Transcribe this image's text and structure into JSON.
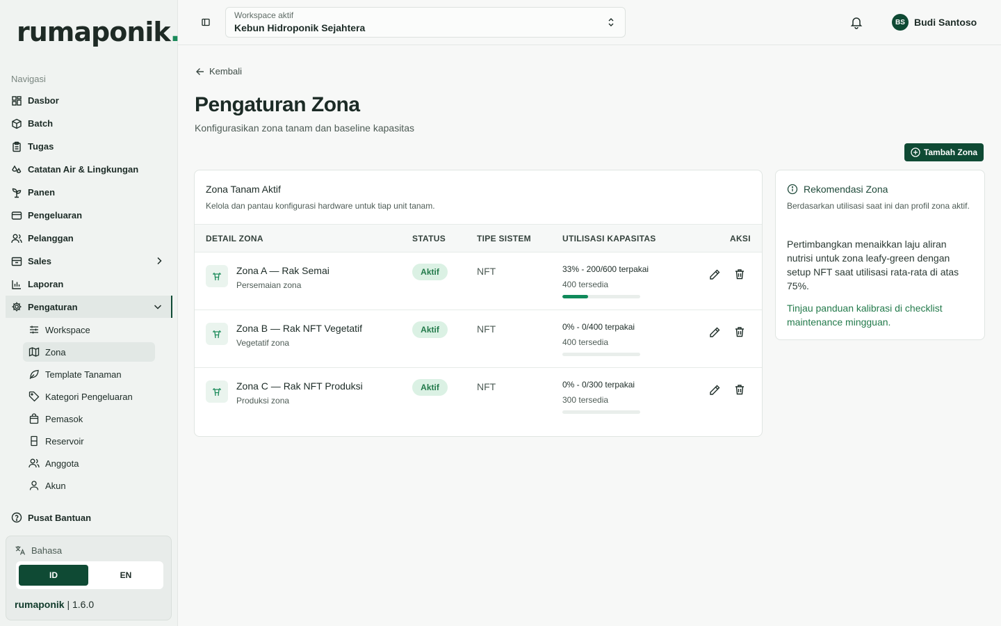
{
  "brand": {
    "logo_text": "rumaponik",
    "logo_dot": "."
  },
  "sidebar": {
    "heading": "Navigasi",
    "items": [
      {
        "label": "Dasbor",
        "icon": "dashboard-icon"
      },
      {
        "label": "Batch",
        "icon": "box-icon"
      },
      {
        "label": "Tugas",
        "icon": "clipboard-icon"
      },
      {
        "label": "Catatan Air & Lingkungan",
        "icon": "droplets-icon"
      },
      {
        "label": "Panen",
        "icon": "sprout-icon"
      },
      {
        "label": "Pengeluaran",
        "icon": "wallet-icon"
      },
      {
        "label": "Pelanggan",
        "icon": "users-icon"
      },
      {
        "label": "Sales",
        "icon": "archive-icon"
      },
      {
        "label": "Laporan",
        "icon": "bar-chart-icon"
      },
      {
        "label": "Pengaturan",
        "icon": "gear-icon"
      }
    ],
    "settings_sub": [
      {
        "label": "Workspace",
        "icon": "sliders-icon"
      },
      {
        "label": "Zona",
        "icon": "map-icon"
      },
      {
        "label": "Template Tanaman",
        "icon": "leaf-icon"
      },
      {
        "label": "Kategori Pengeluaran",
        "icon": "tag-icon"
      },
      {
        "label": "Pemasok",
        "icon": "shopping-bag-icon"
      },
      {
        "label": "Reservoir",
        "icon": "tank-icon"
      },
      {
        "label": "Anggota",
        "icon": "users-icon"
      },
      {
        "label": "Akun",
        "icon": "user-icon"
      }
    ],
    "help_label": "Pusat Bantuan",
    "language": {
      "title": "Bahasa",
      "options": [
        "ID",
        "EN"
      ],
      "selected": "ID"
    },
    "version": {
      "name": "rumaponik",
      "separator": "|",
      "number": "1.6.0"
    }
  },
  "topbar": {
    "workspace_label": "Workspace aktif",
    "workspace_value": "Kebun Hidroponik Sejahtera",
    "user_initials": "BS",
    "user_name": "Budi Santoso"
  },
  "page": {
    "back_label": "Kembali",
    "title": "Pengaturan Zona",
    "subtitle": "Konfigurasikan zona tanam dan baseline kapasitas",
    "add_button": "Tambah Zona"
  },
  "zones_card": {
    "title": "Zona Tanam Aktif",
    "subtitle": "Kelola dan pantau konfigurasi hardware untuk tiap unit tanam.",
    "columns": [
      "DETAIL ZONA",
      "STATUS",
      "TIPE SISTEM",
      "UTILISASI KAPASITAS",
      "AKSI"
    ],
    "rows": [
      {
        "name": "Zona A — Rak Semai",
        "desc": "Persemaian zona",
        "status": "Aktif",
        "system": "NFT",
        "util": "33% - 200/600 terpakai",
        "available": "400 tersedia",
        "util_fraction": 0.33
      },
      {
        "name": "Zona B — Rak NFT Vegetatif",
        "desc": "Vegetatif zona",
        "status": "Aktif",
        "system": "NFT",
        "util": "0% - 0/400 terpakai",
        "available": "400 tersedia",
        "util_fraction": 0
      },
      {
        "name": "Zona C — Rak NFT Produksi",
        "desc": "Produksi zona",
        "status": "Aktif",
        "system": "NFT",
        "util": "0% - 0/300 terpakai",
        "available": "300 tersedia",
        "util_fraction": 0
      }
    ]
  },
  "recommendation": {
    "title": "Rekomendasi Zona",
    "subtitle": "Berdasarkan utilisasi saat ini dan profil zona aktif.",
    "body": "Pertimbangkan menaikkan laju aliran nutrisi untuk zona leafy-green dengan setup NFT saat utilisasi rata-rata di atas 75%.",
    "link": "Tinjau panduan kalibrasi di checklist maintenance mingguan."
  },
  "colors": {
    "brand_dark": "#0f4a34",
    "accent_green": "#0f8a5a",
    "badge_bg": "#dbf1e4"
  }
}
